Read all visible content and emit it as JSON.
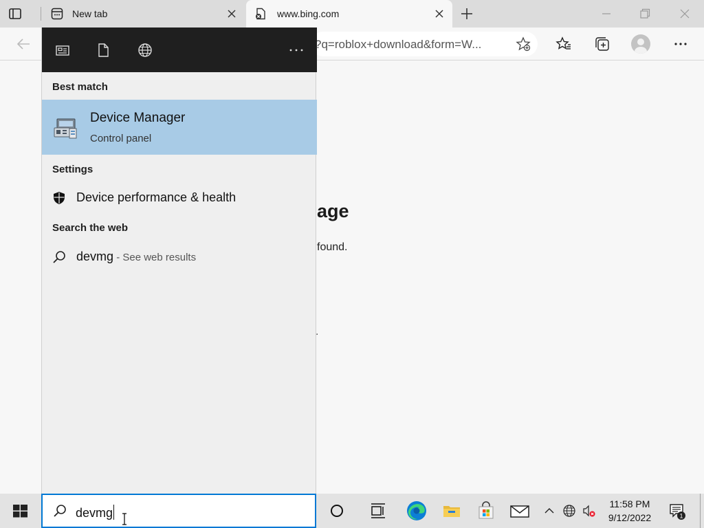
{
  "browser": {
    "tabs": [
      {
        "title": "New tab"
      },
      {
        "title": "www.bing.com"
      }
    ],
    "address_url": "?q=roblox+download&form=W..."
  },
  "page": {
    "heading_fragment": "age",
    "text_fragment": "found.",
    "dot_fragment": "."
  },
  "start_panel": {
    "best_match_label": "Best match",
    "best_match": {
      "name": "Device Manager",
      "subtitle": "Control panel"
    },
    "settings_label": "Settings",
    "settings_items": [
      {
        "label": "Device performance & health"
      }
    ],
    "web_label": "Search the web",
    "web_item": {
      "query": "devmg",
      "hint": " - See web results"
    },
    "more_glyph": "···"
  },
  "taskbar": {
    "search_value": "devmg",
    "time": "11:58 PM",
    "date": "9/12/2022",
    "notification_count": "1"
  },
  "colors": {
    "selection": "#a8cbe6",
    "panel_header": "#1f1f1f",
    "accent": "#0078d4"
  }
}
